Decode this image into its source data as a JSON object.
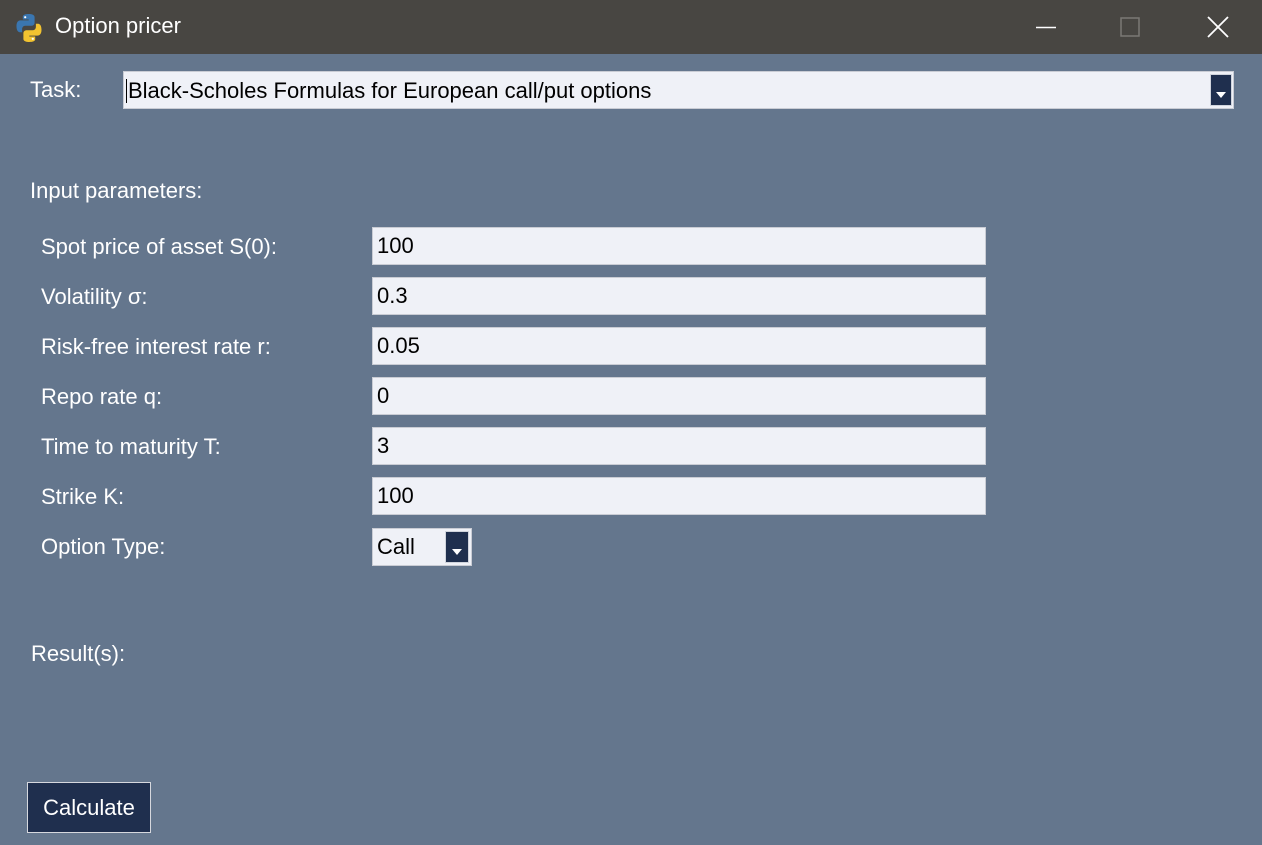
{
  "window": {
    "title": "Option pricer",
    "icon": "python-icon",
    "controls": [
      "minimize-icon",
      "maximize-icon",
      "close-icon"
    ]
  },
  "task": {
    "label": "Task:",
    "selected": "Black-Scholes Formulas for European call/put options"
  },
  "inputs": {
    "section_label": "Input parameters:",
    "fields": [
      {
        "label": "Spot price of asset S(0):",
        "value": "100"
      },
      {
        "label": "Volatility σ:",
        "value": "0.3"
      },
      {
        "label": "Risk-free interest rate r:",
        "value": "0.05"
      },
      {
        "label": "Repo rate q:",
        "value": "0"
      },
      {
        "label": "Time to maturity T:",
        "value": "3"
      },
      {
        "label": "Strike K:",
        "value": "100"
      }
    ],
    "option_type": {
      "label": "Option Type:",
      "selected": "Call"
    }
  },
  "results": {
    "label": "Result(s):"
  },
  "actions": {
    "calculate_label": "Calculate"
  },
  "colors": {
    "background": "#64768d",
    "titlebar": "#484642",
    "field_background": "#eff1f7",
    "button_background": "#1f2f4e",
    "text_light": "#ffffff"
  }
}
